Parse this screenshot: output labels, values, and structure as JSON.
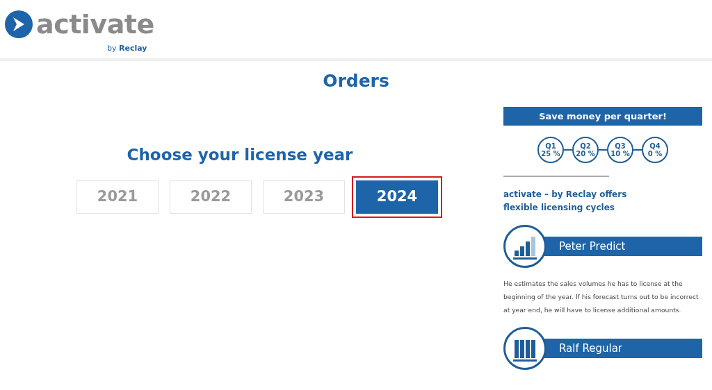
{
  "logo": {
    "wordmark": "activate",
    "byline_prefix": "by",
    "byline_brand": "Reclay"
  },
  "page_title": "Orders",
  "license_year": {
    "heading": "Choose your license year",
    "years": [
      {
        "label": "2021",
        "selected": false
      },
      {
        "label": "2022",
        "selected": false
      },
      {
        "label": "2023",
        "selected": false
      },
      {
        "label": "2024",
        "selected": true
      }
    ]
  },
  "sidebar": {
    "banner": "Save money per quarter!",
    "quarters": [
      {
        "label": "Q1",
        "discount": "25 %"
      },
      {
        "label": "Q2",
        "discount": "20 %"
      },
      {
        "label": "Q3",
        "discount": "10 %"
      },
      {
        "label": "Q4",
        "discount": "0 %"
      }
    ],
    "intro_lines": [
      "activate – by Reclay offers",
      "flexible licensing cycles"
    ],
    "profiles": [
      {
        "kind": "rising",
        "name": "Peter Predict",
        "description": "He estimates the sales volumes he has to license at the beginning of the year. If his forecast turns out to be incorrect at year end, he will have to license additional amounts."
      },
      {
        "kind": "even",
        "name": "Ralf Regular"
      }
    ]
  }
}
